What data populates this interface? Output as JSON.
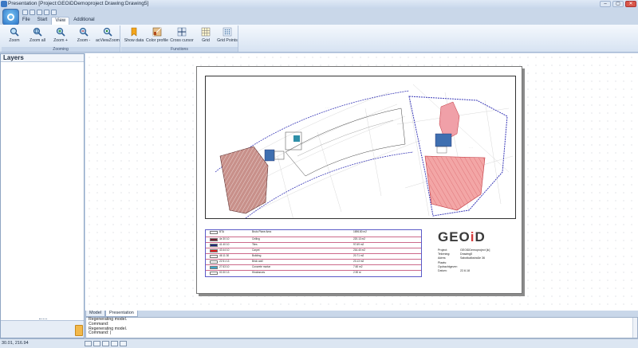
{
  "window": {
    "title": "Presentation [Project:GEOiDDemoproject Drawing:Drawing5]",
    "minimize": "–",
    "maximize": "▢",
    "close": "✕"
  },
  "menu": [
    "File",
    "Start",
    "View",
    "Additional"
  ],
  "ribbon": {
    "groups": [
      {
        "label": "Zooming",
        "buttons": [
          "Zoom",
          "Zoom all",
          "Zoom +",
          "Zoom -",
          "acViewZoom"
        ]
      },
      {
        "label": "Functions",
        "buttons": [
          "Show data",
          "Color profile",
          "Cross cursor",
          "Grid",
          "Grid Points"
        ]
      }
    ],
    "active_button": "Grid"
  },
  "layers": {
    "title": "Layers"
  },
  "legend": {
    "header": {
      "code": "BTA",
      "name": "Bruto Plane Area",
      "value": "1696.80 m2"
    },
    "rows": [
      {
        "code": "4e 30 10",
        "name": "Ceiling",
        "value": "220.13 m2",
        "color": "#6b1f2e"
      },
      {
        "code": "41 40 10",
        "name": "Tiles",
        "value": "97.69 m2",
        "color": "#1e2a7a"
      },
      {
        "code": "43 44 10",
        "name": "Carpet",
        "value": "216.40 m2",
        "color": "#e02020"
      },
      {
        "code": "46 11 30",
        "name": "Building",
        "value": "20.71 m2",
        "color": "#ffffff"
      },
      {
        "code": "22 51 13",
        "name": "Brick wall",
        "value": "23.13 m2",
        "color": "#ffffff"
      },
      {
        "code": "27 63 10",
        "name": "Concrete mortar",
        "value": "7.60 m2",
        "color": "#3aa7c8"
      },
      {
        "code": "00 30 13",
        "name": "Hindrances",
        "value": "2.90 st",
        "color": "#ffffff"
      }
    ]
  },
  "titleblock": {
    "logo": "GEOiD",
    "fields": [
      {
        "k": "Project:",
        "v": "GEOiDDemoproject [ic]"
      },
      {
        "k": "Tekening:",
        "v": "Drawing5"
      },
      {
        "k": "Adres:",
        "v": "Sabotkalkstraße 36"
      },
      {
        "k": "Plaats:",
        "v": ""
      },
      {
        "k": "Opdrachtgever:",
        "v": ""
      },
      {
        "k": "Datum:",
        "v": "22.6.18"
      }
    ]
  },
  "tabs": [
    "Model",
    "Presentation"
  ],
  "active_tab": "Presentation",
  "command": {
    "lines": [
      "Regenerating model.",
      "Command:",
      "Regenerating model.",
      "Command: |"
    ]
  },
  "status": {
    "coords": "30.01, 216.94"
  }
}
